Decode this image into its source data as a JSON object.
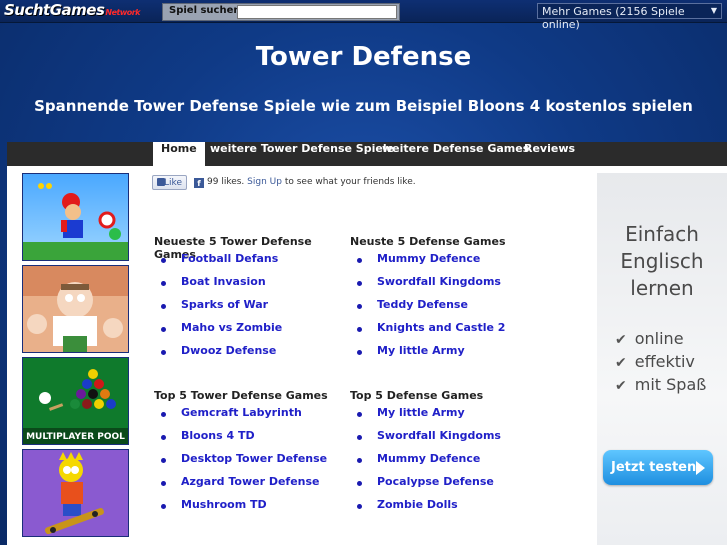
{
  "topbar": {
    "logo_main": "SuchtGames",
    "logo_suffix": "Network",
    "search_label": "Spiel suchen:",
    "search_value": "",
    "games_select": "Mehr Games (2156 Spiele online)"
  },
  "header": {
    "title": "Tower Defense",
    "subtitle": "Spannende Tower Defense Spiele wie zum Beispiel Bloons 4 kostenlos spielen"
  },
  "nav": {
    "items": [
      {
        "label": "Home"
      },
      {
        "label": "weitere Tower Defense Spiele"
      },
      {
        "label": "weitere Defense Games"
      },
      {
        "label": "Reviews"
      }
    ]
  },
  "thumbnails": [
    {
      "label": ""
    },
    {
      "label": ""
    },
    {
      "label": "MULTIPLAYER POOL"
    },
    {
      "label": ""
    }
  ],
  "like": {
    "button": "Like",
    "count_text": "99 likes.",
    "signup": "Sign Up",
    "rest": "to see what your friends like."
  },
  "lists": {
    "newest_td": {
      "title": "Neueste 5 Tower Defense Games",
      "items": [
        "Football Defans",
        "Boat Invasion",
        "Sparks of War",
        "Maho vs Zombie",
        "Dwooz Defense"
      ]
    },
    "newest_def": {
      "title": "Neuste 5 Defense Games",
      "items": [
        "Mummy Defence",
        "Swordfall Kingdoms",
        "Teddy Defense",
        "Knights and Castle 2",
        "My little Army"
      ]
    },
    "top_td": {
      "title": "Top 5 Tower Defense Games",
      "items": [
        "Gemcraft Labyrinth",
        "Bloons 4 TD",
        "Desktop Tower Defense",
        "Azgard Tower Defense",
        "Mushroom TD"
      ]
    },
    "top_def": {
      "title": "Top 5 Defense Games",
      "items": [
        "My little Army",
        "Swordfall Kingdoms",
        "Mummy Defence",
        "Pocalypse Defense",
        "Zombie Dolls"
      ]
    }
  },
  "ad": {
    "line1": "Einfach",
    "line2": "Englisch",
    "line3": "lernen",
    "bullets": [
      "online",
      "effektiv",
      "mit Spaß"
    ],
    "button": "Jetzt testen"
  }
}
